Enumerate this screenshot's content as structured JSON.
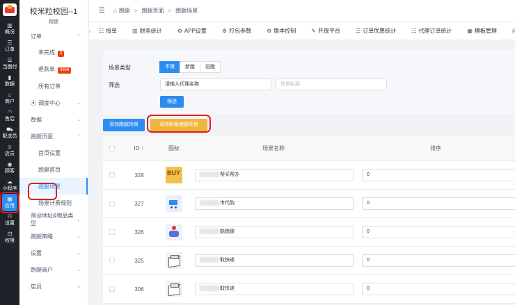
{
  "rail": {
    "items": [
      {
        "label": "概况",
        "icon": "overview-icon",
        "glyph": "▥"
      },
      {
        "label": "订单",
        "icon": "order-icon",
        "glyph": "☰"
      },
      {
        "label": "当面付",
        "icon": "pay-icon",
        "glyph": "☰"
      },
      {
        "label": "数据",
        "icon": "chart-icon",
        "glyph": "▮"
      },
      {
        "label": "商户",
        "icon": "shop-icon",
        "glyph": "⌂"
      },
      {
        "label": "售后",
        "icon": "headset-icon",
        "glyph": "◠"
      },
      {
        "label": "配送员",
        "icon": "courier-icon",
        "glyph": "⛟"
      },
      {
        "label": "店员",
        "icon": "staff-icon",
        "glyph": "☺"
      },
      {
        "label": "顾客",
        "icon": "customer-icon",
        "glyph": "◉"
      },
      {
        "label": "小程序",
        "icon": "miniapp-icon",
        "glyph": "☁"
      },
      {
        "label": "应用",
        "icon": "apps-icon",
        "glyph": "▦"
      },
      {
        "label": "设置",
        "icon": "settings-icon",
        "glyph": "⚇"
      },
      {
        "label": "权限",
        "icon": "lock-icon",
        "glyph": "⊡"
      }
    ]
  },
  "sidebar": {
    "title": "校米粒校园--1",
    "subtitle": "跑腿",
    "items": [
      {
        "label": "订单",
        "chev": "⌃",
        "sub": false
      },
      {
        "label": "未完成",
        "badge": "3",
        "sub": true
      },
      {
        "label": "退款单",
        "badge": "4364",
        "sub": true
      },
      {
        "label": "所有订单",
        "sub": true
      },
      {
        "label": "调度中心",
        "chev": "⌄",
        "sub": false,
        "pin": "⦿"
      },
      {
        "label": "数据",
        "chev": "⌄",
        "sub": false
      },
      {
        "label": "跑腿页面",
        "chev": "⌃",
        "sub": false
      },
      {
        "label": "首页设置",
        "sub": true
      },
      {
        "label": "跑腿首页",
        "sub": true
      },
      {
        "label": "跑腿场景",
        "sub": true,
        "active": true
      },
      {
        "label": "场景计费规则",
        "sub": true
      },
      {
        "label": "预设地址&物品类型",
        "chev": "⌄",
        "sub": false
      },
      {
        "label": "跑腿策略",
        "chev": "⌄",
        "sub": false
      },
      {
        "label": "设置",
        "chev": "⌄",
        "sub": false
      },
      {
        "label": "跑腿商户",
        "chev": "⌄",
        "sub": false
      },
      {
        "label": "店员",
        "chev": "⌄",
        "sub": false
      }
    ]
  },
  "breadcrumb": {
    "menu_glyph": "☰",
    "home_glyph": "⌂",
    "items": [
      "跑腿",
      "跑腿页面",
      "跑腿场景"
    ],
    "sep": ">"
  },
  "tabs": [
    {
      "label": "接单",
      "icon": "list-icon",
      "glyph": "☷"
    },
    {
      "label": "财务统计",
      "icon": "finance-icon",
      "glyph": "▥"
    },
    {
      "label": "APP设置",
      "icon": "app-settings-icon",
      "glyph": "⚙"
    },
    {
      "label": "打包参数",
      "icon": "package-icon",
      "glyph": "⚙"
    },
    {
      "label": "版本控制",
      "icon": "version-icon",
      "glyph": "⚙"
    },
    {
      "label": "开放平台",
      "icon": "platform-icon",
      "glyph": "✎"
    },
    {
      "label": "订单优惠统计",
      "icon": "discount-icon",
      "glyph": "☷"
    },
    {
      "label": "代理订单统计",
      "icon": "agent-icon",
      "glyph": "☷"
    },
    {
      "label": "模板管理",
      "icon": "template-icon",
      "glyph": "▦"
    },
    {
      "label": "打印",
      "icon": "print-icon",
      "glyph": "⎙"
    }
  ],
  "filter": {
    "scene_type_label": "场景类型",
    "segments": [
      "不限",
      "新版",
      "旧版"
    ],
    "filter_label": "筛选",
    "agent_input_value": "请输入代理名称",
    "scene_input_placeholder": "场景标题",
    "filter_button": "筛选"
  },
  "actions": {
    "add_scene": "添加跑腿场景",
    "add_new_scene": "添加新版跑腿场景"
  },
  "table": {
    "headers": {
      "id": "ID",
      "icon": "图标",
      "name": "场景名称",
      "sort": "排序"
    },
    "rows": [
      {
        "id": "328",
        "icon": "buy",
        "name_suffix": "帮买帮办",
        "sort": "0"
      },
      {
        "id": "327",
        "icon": "cart",
        "name_suffix": "市代购",
        "sort": "0"
      },
      {
        "id": "326",
        "icon": "run",
        "name_suffix": "能跑腿",
        "sort": "0"
      },
      {
        "id": "325",
        "icon": "box",
        "name_suffix": "取快递",
        "sort": "0"
      },
      {
        "id": "306",
        "icon": "box",
        "name_suffix": "取快递",
        "sort": "0"
      }
    ]
  }
}
